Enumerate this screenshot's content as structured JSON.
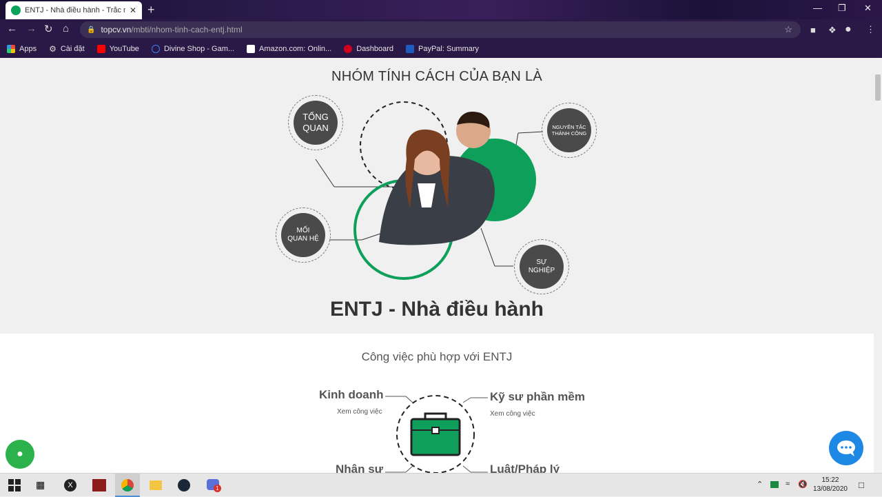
{
  "browser": {
    "tab_title": "ENTJ - Nhà điều hành - Trắc nghiệm",
    "tab_close": "✕",
    "new_tab": "+",
    "url_host": "topcv.vn",
    "url_path": "/mbti/nhom-tinh-cach-entj.html",
    "bookmarks": [
      {
        "label": "Apps",
        "color": "#e74c3c"
      },
      {
        "label": "Cài đặt",
        "color": "#dddddd"
      },
      {
        "label": "YouTube",
        "color": "#ff0000"
      },
      {
        "label": "Divine Shop - Gam...",
        "color": "#3b82f6"
      },
      {
        "label": "Amazon.com: Onlin...",
        "color": "#ffffff"
      },
      {
        "label": "Dashboard",
        "color": "#d0021b"
      },
      {
        "label": "PayPal: Summary",
        "color": "#1e5bbf"
      }
    ]
  },
  "hero": {
    "heading": "NHÓM TÍNH CÁCH CỦA BẠN LÀ",
    "bubbles": {
      "overview": "TỔNG QUAN",
      "success": "NGUYÊN TẮC THÀNH CÔNG",
      "relations": "MỐI QUAN HỆ",
      "career": "SỰ NGHIỆP"
    },
    "type_title": "ENTJ - Nhà điều hành"
  },
  "jobs": {
    "heading": "Công việc phù hợp với ENTJ",
    "items": [
      {
        "name": "Kinh doanh",
        "link": "Xem công việc"
      },
      {
        "name": "Kỹ sư phần mềm",
        "link": "Xem công việc"
      },
      {
        "name": "Nhân sự"
      },
      {
        "name": "Luật/Pháp lý"
      }
    ]
  },
  "taskbar": {
    "time": "15:22",
    "date": "13/08/2020",
    "badge": "1"
  },
  "colors": {
    "accent_green": "#0e9f5b",
    "chat_blue": "#1e88e5"
  }
}
